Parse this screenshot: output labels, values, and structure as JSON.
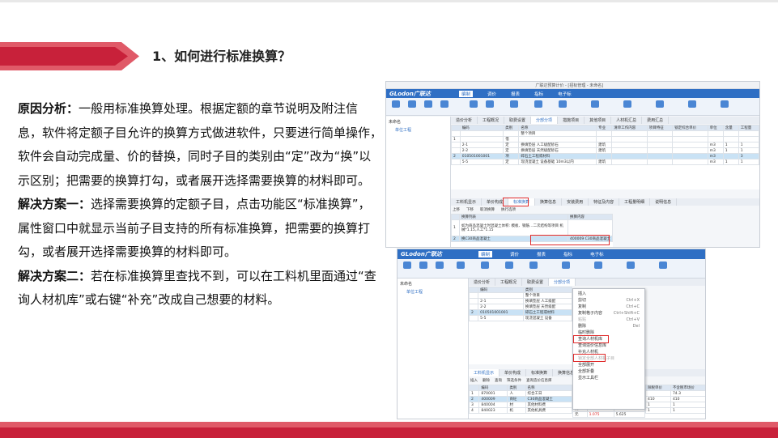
{
  "title": "1、如何进行标准换算？",
  "paragraphs": [
    {
      "label": "原因分析：",
      "text": "一般用标准换算处理。根据定额的章节说明及附注信息，软件将定额子目允许的换算方式做进软件，只要进行简单操作，软件会自动完成量、价的替换，同时子目的类别由“定”改为“换”以示区别；把需要的换算打勾，或者展开选择需要换算的材料即可。"
    },
    {
      "label": "解决方案一：",
      "text": "选择需要换算的定额子目，点击功能区“标准换算”，属性窗口中就显示当前子目支持的所有标准换算，把需要的换算打勾，或者展开选择需要换算的材料即可。"
    },
    {
      "label": "解决方案二：",
      "text": "若在标准换算里查找不到，可以在工料机里面通过“查询人材机库”或右键“补充”改成自己想要的材料。"
    }
  ],
  "screenshot1": {
    "window_title": "广联达预算计价 - [招标管理 - 未命名]",
    "logo": "GLodon广联达",
    "menu": [
      "编制",
      "调价",
      "报表",
      "指标",
      "电子标"
    ],
    "active_menu": "编制",
    "tree": [
      "未命名",
      "单位工程"
    ],
    "tabs": [
      "造价分析",
      "工程概况",
      "取费设置",
      "分部分项",
      "措施项目",
      "其他项目",
      "人材机汇总",
      "费用汇总"
    ],
    "active_tab": "分部分项",
    "grid_header": [
      "编码",
      "类别",
      "名称",
      "专业",
      "清单工作内容",
      "项目特征",
      "锁定综合单价",
      "单位",
      "含量",
      "工程量"
    ],
    "grid_rows": [
      [
        "",
        "",
        "整个项目",
        "",
        "",
        "",
        "",
        "",
        "",
        ""
      ],
      [
        "1",
        "",
        "借",
        "",
        "",
        "",
        "",
        "",
        "",
        ""
      ],
      [
        "",
        "2-1",
        "定",
        "换填垫层 人工级配砂石",
        "建筑",
        "",
        "",
        "m3",
        "1",
        "1"
      ],
      [
        "",
        "2-2",
        "定",
        "换填垫层 天然级配砂石",
        "建筑",
        "",
        "",
        "m3",
        "1",
        "1"
      ],
      [
        "2",
        "010501001001",
        "项",
        "碎石土工程或材料",
        "",
        "",
        "",
        "m3",
        "",
        "3"
      ],
      [
        "",
        "5-5",
        "定",
        "现浇混凝土 设备基础 10m3以内",
        "建筑",
        "",
        "",
        "m3",
        "1",
        "1"
      ]
    ],
    "bottom_tabs": [
      "工料机显示",
      "单价构成",
      "标准换算",
      "换算信息",
      "安装费用",
      "特征及内容",
      "工程量明细",
      "说明信息"
    ],
    "active_bottom_tab": "标准换算",
    "sub_toolbar": [
      "上移",
      "下移",
      "取消换算",
      "执行选项"
    ],
    "conv_header": [
      "换算列表",
      "换算内容"
    ],
    "conv_rows": [
      {
        "no": "1",
        "text": "如为商品混凝土时混凝土体积: 模板、钢筋…二次结构等项目 机械*1.15,人工*1.15"
      },
      {
        "no": "2",
        "text": "换C30商品混凝土",
        "content": "400009  C30商品混凝土"
      }
    ]
  },
  "screenshot2": {
    "logo": "GLodon广联达",
    "menu": [
      "编制",
      "调价",
      "报表",
      "指标",
      "电子标"
    ],
    "active_menu": "编制",
    "tree": [
      "未命名",
      "单位工程"
    ],
    "tabs": [
      "造价分析",
      "工程概况",
      "取费设置",
      "分部分项"
    ],
    "context_menu": [
      {
        "label": "插入",
        "key": ""
      },
      {
        "label": "剪切",
        "key": "Ctrl+X"
      },
      {
        "label": "复制",
        "key": "Ctrl+C"
      },
      {
        "label": "复制格子内容",
        "key": "Ctrl+Shift+C"
      },
      {
        "label": "粘贴",
        "key": "Ctrl+V"
      },
      {
        "label": "删除",
        "key": "Del"
      },
      {
        "label": "临时删除",
        "key": ""
      },
      {
        "label": "查询人材机库",
        "key": ""
      },
      {
        "label": "查询造价信息库",
        "key": ""
      },
      {
        "label": "补充人材机",
        "key": ""
      },
      {
        "label": "锁定全部人材机子目",
        "key": ""
      },
      {
        "label": "全部展开",
        "key": ""
      },
      {
        "label": "全部折叠",
        "key": ""
      },
      {
        "label": "显示工具栏",
        "key": ""
      }
    ],
    "grid_rows": [
      [
        "",
        "整个项目",
        ""
      ],
      [
        "2-1",
        "定",
        "换填垫层 人工级配"
      ],
      [
        "2-2",
        "定",
        "换填垫层 天然级配"
      ],
      [
        "010501001001",
        "项",
        "碎石土工程或材料"
      ],
      [
        "5-5",
        "定",
        "现浇混凝土 设备"
      ]
    ],
    "bottom_tabs": [
      "工料机显示",
      "单价构成",
      "标准换算",
      "换算信息"
    ],
    "sub_toolbar": [
      "插入",
      "删除",
      "查询",
      "筛选条件",
      "查询造价信息库"
    ],
    "gl_header": [
      "编码",
      "类别",
      "名称",
      "规格"
    ],
    "gl_rows": [
      [
        "1",
        "870001",
        "人",
        "综合工日"
      ],
      [
        "2",
        "400009",
        "商砼",
        "C30商品混凝土"
      ],
      [
        "3",
        "840004",
        "材",
        "其他材料费"
      ],
      [
        "4",
        "840023",
        "机",
        "其他机具费"
      ]
    ],
    "right_values": [
      [
        "",
        "74.3"
      ],
      [
        "410",
        "410"
      ],
      [
        "1",
        "1"
      ],
      [
        "1",
        "1"
      ]
    ],
    "mid_values": [
      [
        "元",
        "0.366",
        "10.098"
      ],
      [
        "元",
        "1.075",
        "5.625"
      ]
    ]
  },
  "colors": {
    "accent_red": "#c8213a",
    "ribbon_blue": "#2f6fc4"
  }
}
